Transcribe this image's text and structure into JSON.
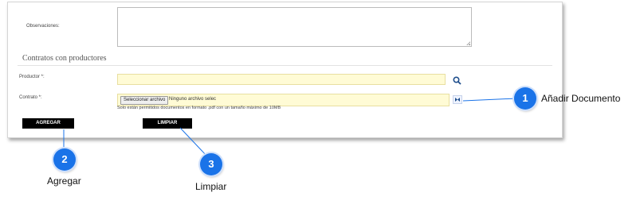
{
  "form": {
    "observaciones_label": "Observaciones:",
    "section_title": "Contratos con productores",
    "productor_label": "Productor *:",
    "contrato_label": "Contrato *:",
    "file_button_label": "Seleccionar archivo",
    "no_file_text": "Ninguno archivo selec",
    "file_hint": "Solo están permitidos documentos en formato .pdf con un tamaño máximo de 10MB",
    "agregar_label": "AGREGAR",
    "limpiar_label": "LIMPIAR",
    "field_color": "#fffbd5"
  },
  "callouts": [
    {
      "number": "1",
      "label": "Añadir Documento"
    },
    {
      "number": "2",
      "label": "Agregar"
    },
    {
      "number": "3",
      "label": "Limpiar"
    }
  ],
  "colors": {
    "badge": "#1a73e8",
    "button": "#000000"
  },
  "icons": {
    "search": "search-icon",
    "attach": "attach-document-icon"
  }
}
